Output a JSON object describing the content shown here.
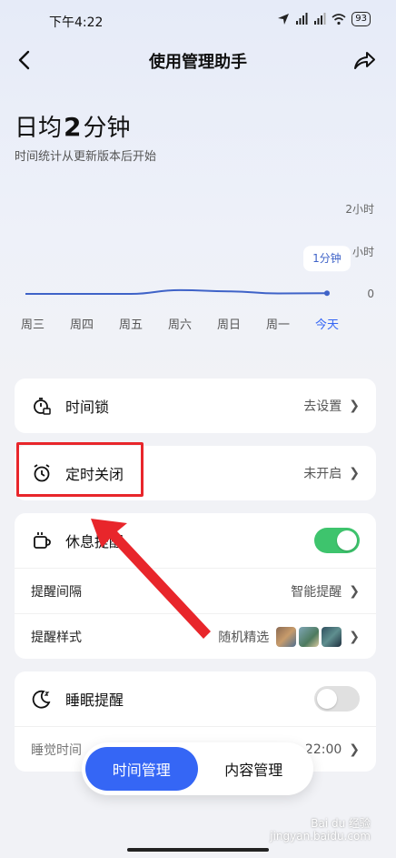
{
  "status_bar": {
    "time": "下午4:22",
    "battery": "93"
  },
  "nav": {
    "title": "使用管理助手"
  },
  "summary": {
    "prefix": "日均",
    "number": "2",
    "unit": "分钟",
    "subtitle": "时间统计从更新版本后开始"
  },
  "chart_data": {
    "type": "line",
    "categories": [
      "周三",
      "周四",
      "周五",
      "周六",
      "周日",
      "周一",
      "今天"
    ],
    "values": [
      0,
      0,
      0,
      0.09,
      0.06,
      0.01,
      0.017
    ],
    "y_tick_labels": [
      "2小时",
      "小时",
      "0"
    ],
    "ylim": [
      0,
      2
    ],
    "tooltip": "1分钟",
    "highlight_category": "今天",
    "colors": {
      "line": "#3f63c8",
      "highlight": "#3566f5"
    }
  },
  "cards": {
    "time_lock": {
      "label": "时间锁",
      "value": "去设置"
    },
    "timer_close": {
      "label": "定时关闭",
      "value": "未开启"
    },
    "rest": {
      "label": "休息提醒",
      "toggle": "on",
      "interval_label": "提醒间隔",
      "interval_value": "智能提醒",
      "style_label": "提醒样式",
      "style_value": "随机精选"
    },
    "sleep": {
      "label": "睡眠提醒",
      "toggle": "off",
      "bedtime_label": "睡觉时间",
      "bedtime_value": "22:00"
    }
  },
  "tabs": [
    {
      "label": "时间管理",
      "active": true
    },
    {
      "label": "内容管理",
      "active": false
    }
  ],
  "watermark": {
    "brand": "Bai du 经验",
    "url": "jingyan.baidu.com"
  },
  "colors": {
    "accent": "#3566f5",
    "toggle_on": "#3ec46d",
    "annotation": "#e8262b"
  }
}
